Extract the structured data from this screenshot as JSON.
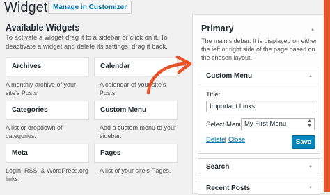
{
  "header": {
    "title": "Widgets",
    "manage_button": "Manage in Customizer"
  },
  "available": {
    "title": "Available Widgets",
    "description": "To activate a widget drag it to a sidebar or click on it. To deactivate a widget and delete its settings, drag it back.",
    "widgets": [
      {
        "name": "Archives",
        "desc": "A monthly archive of your site’s Posts."
      },
      {
        "name": "Calendar",
        "desc": "A calendar of your site’s Posts."
      },
      {
        "name": "Categories",
        "desc": "A list or dropdown of categories."
      },
      {
        "name": "Custom Menu",
        "desc": "Add a custom menu to your sidebar."
      },
      {
        "name": "Meta",
        "desc": "Login, RSS, & WordPress.org links."
      },
      {
        "name": "Pages",
        "desc": "A list of your site’s Pages."
      }
    ]
  },
  "primary": {
    "title": "Primary",
    "description": "The main sidebar. It is displayed on either the left or right side of the page based on the chosen layout.",
    "custom_menu": {
      "title": "Custom Menu",
      "title_label": "Title:",
      "title_value": "Important Links",
      "select_label": "Select Menu:",
      "select_value": "My First Menu",
      "delete_label": "Delete",
      "separator": "|",
      "close_label": "Close",
      "save_label": "Save"
    },
    "search_widget": "Search",
    "recent_posts_widget": "Recent Posts"
  },
  "colors": {
    "accent": "#0085ba",
    "link": "#0073aa",
    "annotation_arrow": "#e8542a"
  }
}
